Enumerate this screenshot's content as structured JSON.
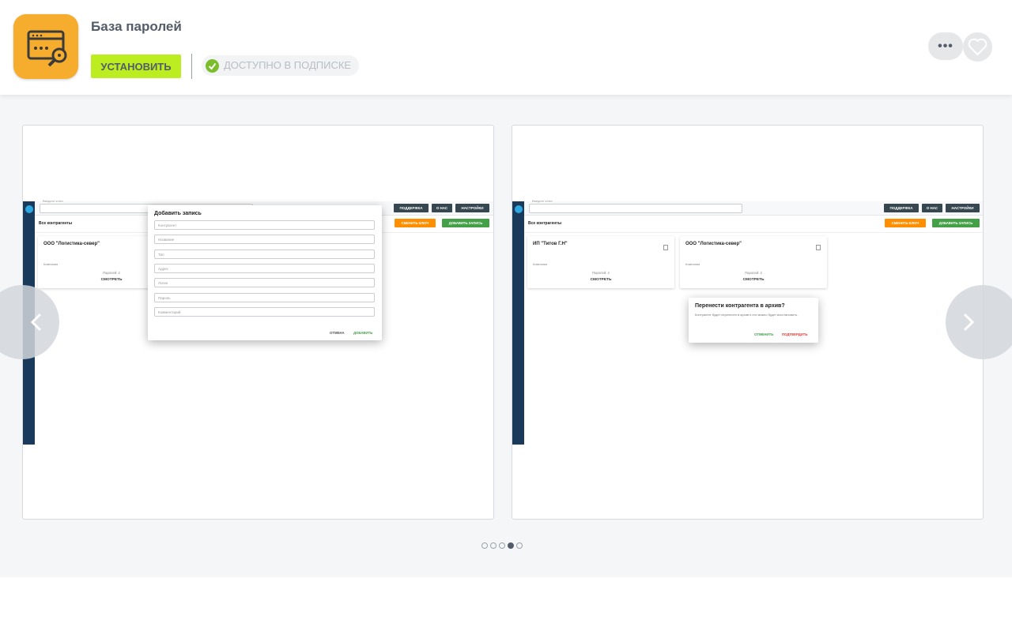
{
  "app": {
    "title": "База паролей",
    "install_label": "Установить",
    "subscription_label": "Доступно в подписке",
    "more_label": "•••",
    "icon_color": "#f6ad2d"
  },
  "colors": {
    "install": "#bbed21",
    "check": "#7bbd2a",
    "sidebar": "#1a3a5c",
    "orange": "#ff8f00",
    "green": "#43a047"
  },
  "screenshots": [
    {
      "search_placeholder": "Введите ключ",
      "buttons": [
        "ПОДДЕРЖКА",
        "О НАС",
        "НАСТРОЙКИ"
      ],
      "section_title": "Все контрагенты",
      "change_key": "СМЕНИТЬ КЛЮЧ",
      "add_record": "ДОБАВИТЬ ЗАПИСЬ",
      "card": {
        "title": "ООО \"Логистика-север\"",
        "subtitle": "Компания",
        "count": "Паролей: 2",
        "view": "СМОТРЕТЬ"
      },
      "dialog": {
        "title": "Добавить запись",
        "fields": [
          "Контрагент",
          "Название",
          "Тип",
          "Адрес",
          "Логин",
          "Пароль",
          "Комментарий"
        ],
        "cancel": "ОТМЕНА",
        "confirm": "ДОБАВИТЬ"
      }
    },
    {
      "search_placeholder": "Введите ключ",
      "buttons": [
        "ПОДДЕРЖКА",
        "О НАС",
        "НАСТРОЙКИ"
      ],
      "section_title": "Все контрагенты",
      "change_key": "СМЕНИТЬ КЛЮЧ",
      "add_record": "ДОБАВИТЬ ЗАПИСЬ",
      "cards": [
        {
          "title": "ИП \"Титов Г.Н\"",
          "subtitle": "Компания",
          "count": "Паролей: 4",
          "view": "СМОТРЕТЬ"
        },
        {
          "title": "ООО \"Логистика-север\"",
          "subtitle": "Компания",
          "count": "Паролей: 2",
          "view": "СМОТРЕТЬ"
        }
      ],
      "dialog": {
        "title": "Перенести контрагента в архив?",
        "text": "Контрагент будет перенесен в архив и его можно будет восстановить.",
        "cancel": "ОТМЕНИТЬ",
        "confirm": "ПОДТВЕРДИТЬ"
      }
    }
  ],
  "pagination": {
    "total": 5,
    "active": 4
  }
}
